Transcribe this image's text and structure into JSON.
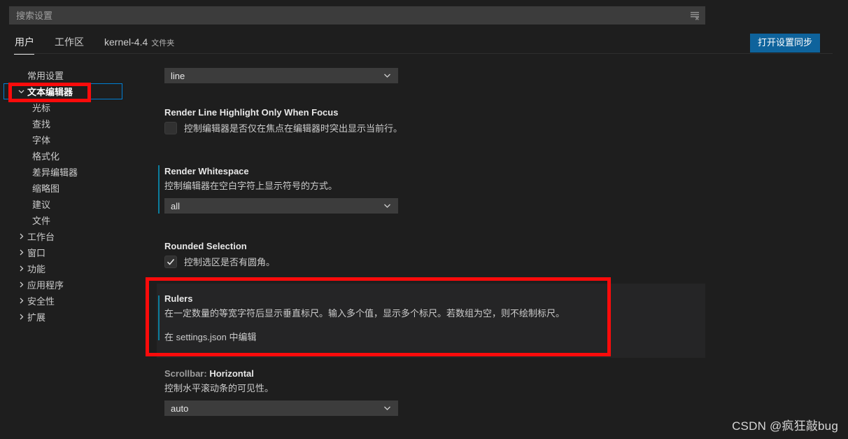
{
  "search": {
    "placeholder": "搜索设置",
    "value": "",
    "filter_icon": "clear-filter-icon"
  },
  "tabs": [
    {
      "label": "用户",
      "suffix": "",
      "active": true
    },
    {
      "label": "工作区",
      "suffix": "",
      "active": false
    },
    {
      "label": "kernel-4.4",
      "suffix": "文件夹",
      "active": false
    }
  ],
  "toolbar": {
    "sync_label": "打开设置同步"
  },
  "sidebar": {
    "items": [
      {
        "label": "常用设置",
        "level": 1,
        "arrow": "none",
        "selected": false
      },
      {
        "label": "文本编辑器",
        "level": 1,
        "arrow": "down",
        "selected": true
      },
      {
        "label": "光标",
        "level": 2,
        "arrow": "none",
        "selected": false
      },
      {
        "label": "查找",
        "level": 2,
        "arrow": "none",
        "selected": false
      },
      {
        "label": "字体",
        "level": 2,
        "arrow": "none",
        "selected": false
      },
      {
        "label": "格式化",
        "level": 2,
        "arrow": "none",
        "selected": false
      },
      {
        "label": "差异编辑器",
        "level": 2,
        "arrow": "none",
        "selected": false
      },
      {
        "label": "缩略图",
        "level": 2,
        "arrow": "none",
        "selected": false
      },
      {
        "label": "建议",
        "level": 2,
        "arrow": "none",
        "selected": false
      },
      {
        "label": "文件",
        "level": 2,
        "arrow": "none",
        "selected": false
      },
      {
        "label": "工作台",
        "level": 1,
        "arrow": "right",
        "selected": false
      },
      {
        "label": "窗口",
        "level": 1,
        "arrow": "right",
        "selected": false
      },
      {
        "label": "功能",
        "level": 1,
        "arrow": "right",
        "selected": false
      },
      {
        "label": "应用程序",
        "level": 1,
        "arrow": "right",
        "selected": false
      },
      {
        "label": "安全性",
        "level": 1,
        "arrow": "right",
        "selected": false
      },
      {
        "label": "扩展",
        "level": 1,
        "arrow": "right",
        "selected": false
      }
    ]
  },
  "settings": {
    "partial_top_select": {
      "value": "line"
    },
    "render_line_highlight_focus": {
      "title": "Render Line Highlight Only When Focus",
      "description": "控制编辑器是否仅在焦点在编辑器时突出显示当前行。",
      "checked": false
    },
    "render_whitespace": {
      "title": "Render Whitespace",
      "description": "控制编辑器在空白字符上显示符号的方式。",
      "value": "all",
      "modified": true
    },
    "rounded_selection": {
      "title": "Rounded Selection",
      "description": "控制选区是否有圆角。",
      "checked": true
    },
    "rulers": {
      "title": "Rulers",
      "description": "在一定数量的等宽字符后显示垂直标尺。输入多个值，显示多个标尺。若数组为空，则不绘制标尺。",
      "link": "在 settings.json 中编辑",
      "modified": true
    },
    "scrollbar_horizontal": {
      "category": "Scrollbar:",
      "name": "Horizontal",
      "description": "控制水平滚动条的可见性。",
      "value": "auto"
    }
  },
  "annotations": {
    "colors": {
      "box": "#fb0b0b",
      "accent": "#0e639c",
      "modified_bar": "#0c7d9d",
      "focus": "#007fd4"
    }
  },
  "watermark": {
    "text": "CSDN @疯狂敲bug"
  }
}
